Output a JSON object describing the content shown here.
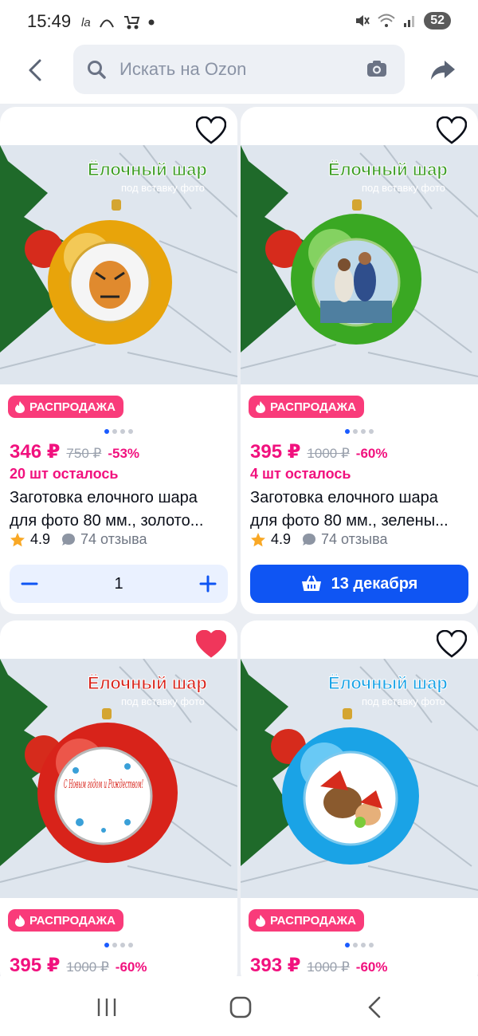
{
  "status": {
    "time": "15:49",
    "left_icons": [
      "la",
      "wifi-arc",
      "stroller",
      "dot"
    ],
    "battery": "52"
  },
  "search": {
    "placeholder": "Искать на Ozon"
  },
  "colors": {
    "accent": "#0f55f3",
    "price": "#f1117e",
    "badge": "#f93b7a",
    "heart_active": "#f0365b"
  },
  "products": [
    {
      "logo_line1": "Ёлочный шар",
      "logo_line2": "под вставку фото",
      "ball_color": "#e8a40a",
      "badge": "РАСПРОДАЖА",
      "price": "346 ₽",
      "old_price": "750 ₽",
      "discount": "-53%",
      "stock": "20 шт осталось",
      "title_line1": "Заготовка елочного шара",
      "title_line2": "для фото 80 мм., золото...",
      "rating": "4.9",
      "reviews": "74 отзыва",
      "quantity": "1",
      "favorite": false,
      "image_slide": 1
    },
    {
      "logo_line1": "Ёлочный шар",
      "logo_line2": "под вставку фото",
      "ball_color": "#3aa823",
      "badge": "РАСПРОДАЖА",
      "price": "395 ₽",
      "old_price": "1000 ₽",
      "discount": "-60%",
      "stock": "4 шт осталось",
      "title_line1": "Заготовка елочного шара",
      "title_line2": "для фото 80 мм., зелены...",
      "rating": "4.9",
      "reviews": "74 отзыва",
      "cart_label": "13 декабря",
      "favorite": false,
      "image_slide": 1
    },
    {
      "logo_line1": "Ёлочный шар",
      "logo_line2": "под вставку фото",
      "ball_color": "#d8231a",
      "insert_text": "С Новым годом и Рождеством!",
      "badge": "РАСПРОДАЖА",
      "price": "395 ₽",
      "old_price": "1000 ₽",
      "discount": "-60%",
      "favorite": true,
      "image_slide": 1
    },
    {
      "logo_line1": "Ёлочный шар",
      "logo_line2": "под вставку фото",
      "ball_color": "#1aa3e6",
      "badge": "РАСПРОДАЖА",
      "price": "393 ₽",
      "old_price": "1000 ₽",
      "discount": "-60%",
      "favorite": false,
      "image_slide": 1
    }
  ],
  "navbar": {
    "items": [
      "recent-apps",
      "home",
      "back"
    ]
  }
}
